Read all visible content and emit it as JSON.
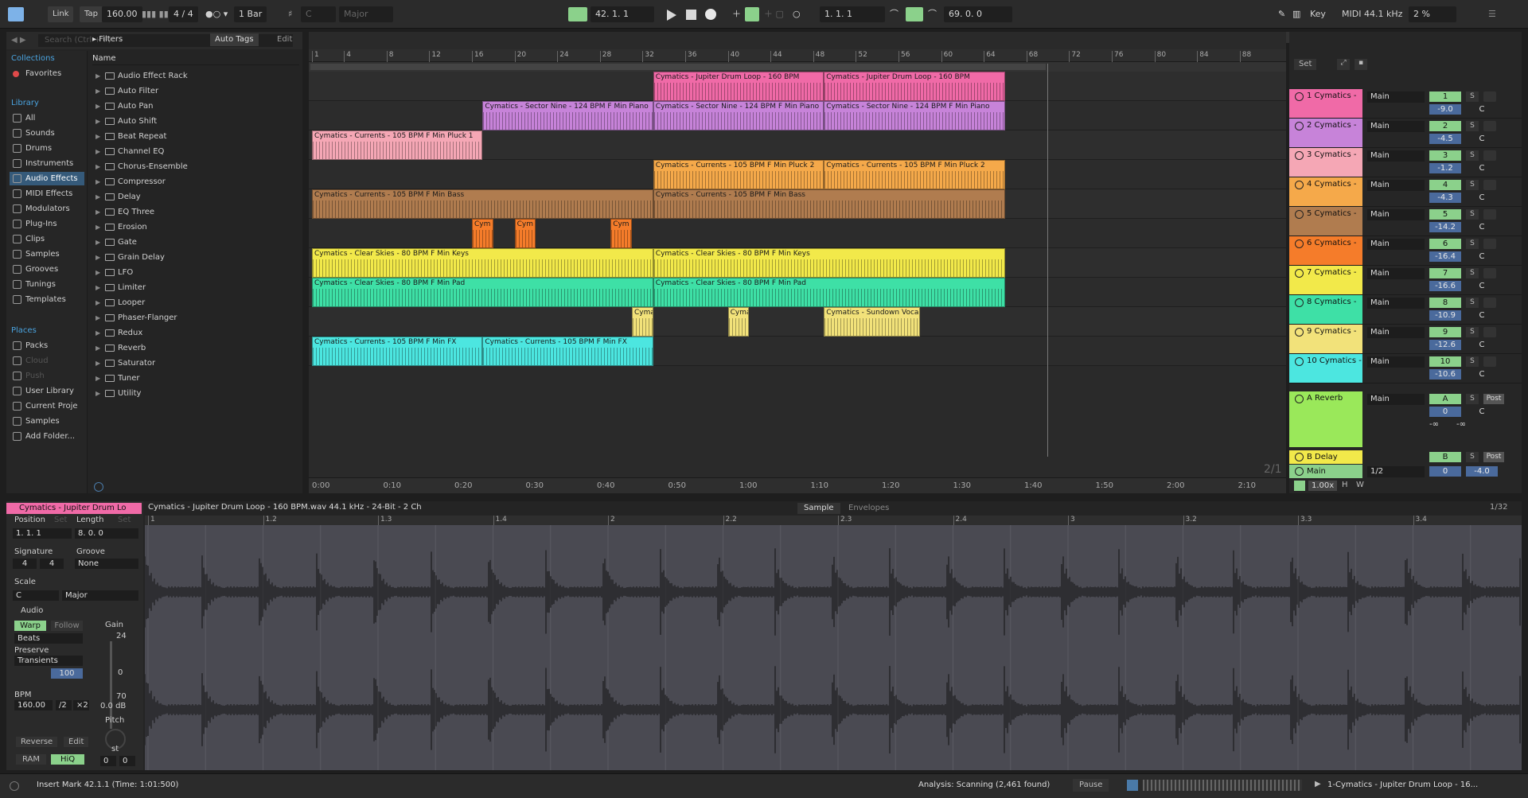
{
  "transport": {
    "link": "Link",
    "tap": "Tap",
    "tempo": "160.00",
    "signature": "4 / 4",
    "quantize": "1 Bar",
    "key": "C",
    "scale": "Major",
    "position": "42.  1.  1",
    "loop_start": "1.  1.  1",
    "loop_length": "69.  0.  0",
    "key_label": "Key",
    "midi_label": "MIDI",
    "sample_rate": "44.1 kHz",
    "cpu": "2 %"
  },
  "browser": {
    "search_placeholder": "Search (Ctrl + F)",
    "filters": "Filters",
    "auto_tags": "Auto Tags",
    "edit": "Edit",
    "name_header": "Name",
    "collections_header": "Collections",
    "favorites": "Favorites",
    "library_header": "Library",
    "library": [
      "All",
      "Sounds",
      "Drums",
      "Instruments",
      "Audio Effects",
      "MIDI Effects",
      "Modulators",
      "Plug-Ins",
      "Clips",
      "Samples",
      "Grooves",
      "Tunings",
      "Templates"
    ],
    "places_header": "Places",
    "places": [
      "Packs",
      "Cloud",
      "Push",
      "User Library",
      "Current Proje",
      "Samples",
      "Add Folder..."
    ],
    "items": [
      "Audio Effect Rack",
      "Auto Filter",
      "Auto Pan",
      "Auto Shift",
      "Beat Repeat",
      "Channel EQ",
      "Chorus-Ensemble",
      "Compressor",
      "Delay",
      "EQ Three",
      "Erosion",
      "Gate",
      "Grain Delay",
      "LFO",
      "Limiter",
      "Looper",
      "Phaser-Flanger",
      "Redux",
      "Reverb",
      "Saturator",
      "Tuner",
      "Utility"
    ]
  },
  "ruler": {
    "bars": [
      "1",
      "4",
      "8",
      "12",
      "16",
      "20",
      "24",
      "28",
      "32",
      "36",
      "40",
      "44",
      "48",
      "52",
      "56",
      "60",
      "64",
      "68",
      "72",
      "76",
      "80",
      "84",
      "88"
    ],
    "time": [
      "0:00",
      "0:10",
      "0:20",
      "0:30",
      "0:40",
      "0:50",
      "1:00",
      "1:10",
      "1:20",
      "1:30",
      "1:40",
      "1:50",
      "2:00",
      "2:10"
    ],
    "zoom_ratio": "2/1"
  },
  "clips": [
    {
      "lane": 0,
      "name": "Cymatics - Jupiter Drum Loop - 160 BPM",
      "color": "#f06aa7",
      "start": 32,
      "end": 48
    },
    {
      "lane": 0,
      "name": "Cymatics - Jupiter Drum Loop - 160 BPM",
      "color": "#f06aa7",
      "start": 48,
      "end": 65
    },
    {
      "lane": 1,
      "name": "Cymatics - Sector Nine - 124 BPM F Min Piano",
      "color": "#c783d9",
      "start": 16,
      "end": 32
    },
    {
      "lane": 1,
      "name": "Cymatics - Sector Nine - 124 BPM F Min Piano",
      "color": "#c783d9",
      "start": 32,
      "end": 48
    },
    {
      "lane": 1,
      "name": "Cymatics - Sector Nine - 124 BPM F Min Piano",
      "color": "#c783d9",
      "start": 48,
      "end": 65
    },
    {
      "lane": 2,
      "name": "Cymatics - Currents - 105 BPM F Min Pluck 1",
      "color": "#f5a7b5",
      "start": 0,
      "end": 16
    },
    {
      "lane": 3,
      "name": "Cymatics - Currents - 105 BPM F Min Pluck 2",
      "color": "#f5a94a",
      "start": 32,
      "end": 48
    },
    {
      "lane": 3,
      "name": "Cymatics - Currents - 105 BPM F Min Pluck 2",
      "color": "#f5a94a",
      "start": 48,
      "end": 65
    },
    {
      "lane": 4,
      "name": "Cymatics - Currents - 105 BPM F Min Bass",
      "color": "#b07c4f",
      "start": 0,
      "end": 32
    },
    {
      "lane": 4,
      "name": "Cymatics - Currents - 105 BPM F Min Bass",
      "color": "#b07c4f",
      "start": 32,
      "end": 65
    },
    {
      "lane": 5,
      "name": "Cym",
      "color": "#f57c2a",
      "start": 15,
      "end": 17
    },
    {
      "lane": 5,
      "name": "Cym",
      "color": "#f57c2a",
      "start": 19,
      "end": 21
    },
    {
      "lane": 5,
      "name": "Cym",
      "color": "#f57c2a",
      "start": 28,
      "end": 30
    },
    {
      "lane": 6,
      "name": "Cymatics - Clear Skies - 80 BPM F Min Keys",
      "color": "#f2e94a",
      "start": 0,
      "end": 32
    },
    {
      "lane": 6,
      "name": "Cymatics - Clear Skies - 80 BPM F Min Keys",
      "color": "#f2e94a",
      "start": 32,
      "end": 65
    },
    {
      "lane": 7,
      "name": "Cymatics - Clear Skies - 80 BPM F Min Pad",
      "color": "#3ee0a6",
      "start": 0,
      "end": 32
    },
    {
      "lane": 7,
      "name": "Cymatics - Clear Skies - 80 BPM F Min Pad",
      "color": "#3ee0a6",
      "start": 32,
      "end": 65
    },
    {
      "lane": 8,
      "name": "Cyma",
      "color": "#f2e27a",
      "start": 30,
      "end": 32
    },
    {
      "lane": 8,
      "name": "Cyma",
      "color": "#f2e27a",
      "start": 39,
      "end": 41
    },
    {
      "lane": 8,
      "name": "Cymatics - Sundown Vocal",
      "color": "#f2e27a",
      "start": 48,
      "end": 57
    },
    {
      "lane": 9,
      "name": "Cymatics - Currents - 105 BPM F Min FX",
      "color": "#4ce6e0",
      "start": 0,
      "end": 16
    },
    {
      "lane": 9,
      "name": "Cymatics - Currents - 105 BPM F Min FX",
      "color": "#4ce6e0",
      "start": 16,
      "end": 32
    }
  ],
  "mixer": {
    "set_label": "Set",
    "tracks": [
      {
        "name": "1 Cymatics -",
        "color": "#f06aa7",
        "out": "Main",
        "num": "1",
        "vol": "-9.0",
        "pan": "C"
      },
      {
        "name": "2 Cymatics -",
        "color": "#c783d9",
        "out": "Main",
        "num": "2",
        "vol": "-4.5",
        "pan": "C"
      },
      {
        "name": "3 Cymatics -",
        "color": "#f5a7b5",
        "out": "Main",
        "num": "3",
        "vol": "-1.2",
        "pan": "C"
      },
      {
        "name": "4 Cymatics -",
        "color": "#f5a94a",
        "out": "Main",
        "num": "4",
        "vol": "-4.3",
        "pan": "C"
      },
      {
        "name": "5 Cymatics -",
        "color": "#b07c4f",
        "out": "Main",
        "num": "5",
        "vol": "-14.2",
        "pan": "C"
      },
      {
        "name": "6 Cymatics -",
        "color": "#f57c2a",
        "out": "Main",
        "num": "6",
        "vol": "-16.4",
        "pan": "C"
      },
      {
        "name": "7 Cymatics -",
        "color": "#f2e94a",
        "out": "Main",
        "num": "7",
        "vol": "-16.6",
        "pan": "C"
      },
      {
        "name": "8 Cymatics -",
        "color": "#3ee0a6",
        "out": "Main",
        "num": "8",
        "vol": "-10.9",
        "pan": "C"
      },
      {
        "name": "9 Cymatics -",
        "color": "#f2e27a",
        "out": "Main",
        "num": "9",
        "vol": "-12.6",
        "pan": "C"
      },
      {
        "name": "10 Cymatics -",
        "color": "#4ce6e0",
        "out": "Main",
        "num": "10",
        "vol": "-10.6",
        "pan": "C"
      }
    ],
    "return_a": {
      "name": "A Reverb",
      "out": "Main",
      "num": "A",
      "vol": "0",
      "pan": "C",
      "post": "Post",
      "inf": "-∞"
    },
    "return_b": {
      "name": "B Delay",
      "num": "B",
      "post": "Post"
    },
    "main": {
      "name": "Main",
      "out": "1/2",
      "num": "0",
      "vol": "-4.0"
    },
    "zoom": "1.00x",
    "h": "H",
    "w": "W"
  },
  "clip_view": {
    "clip_name": "Cymatics - Jupiter Drum Lo",
    "file_info": "Cymatics - Jupiter Drum Loop - 160 BPM.wav  44.1 kHz - 24-Bit - 2 Ch",
    "tab_sample": "Sample",
    "tab_envelopes": "Envelopes",
    "grid": "1/32",
    "position_label": "Position",
    "set_label": "Set",
    "length_label": "Length",
    "position": "1.   1.   1",
    "length": "8.   0.   0",
    "signature_label": "Signature",
    "groove_label": "Groove",
    "sig_num": "4",
    "sig_den": "4",
    "groove": "None",
    "scale_label": "Scale",
    "scale_root": "C",
    "scale_mode": "Major",
    "audio_label": "Audio",
    "warp": "Warp",
    "follow": "Follow",
    "warp_mode": "Beats",
    "preserve_label": "Preserve",
    "preserve": "Transients",
    "loop_val": "100",
    "gain_label": "Gain",
    "gain_max": "24",
    "gain_zero": "0",
    "gain_min": "70",
    "gain_db": "0.0 dB",
    "bpm_label": "BPM",
    "bpm": "160.00",
    "half": "/2",
    "double": "×2",
    "pitch_label": "Pitch",
    "pitch_unit": "st",
    "pitch_a": "0",
    "pitch_b": "0",
    "reverse": "Reverse",
    "edit": "Edit",
    "ram": "RAM",
    "hiq": "HiQ",
    "beats": [
      "1",
      "1.2",
      "1.3",
      "1.4",
      "2",
      "2.2",
      "2.3",
      "2.4",
      "3",
      "3.2",
      "3.3",
      "3.4"
    ]
  },
  "status": {
    "message": "Insert Mark 42.1.1 (Time: 1:01:500)",
    "analysis": "Analysis: Scanning (2,461 found)",
    "pause": "Pause",
    "clip": "1-Cymatics - Jupiter Drum Loop - 16..."
  }
}
